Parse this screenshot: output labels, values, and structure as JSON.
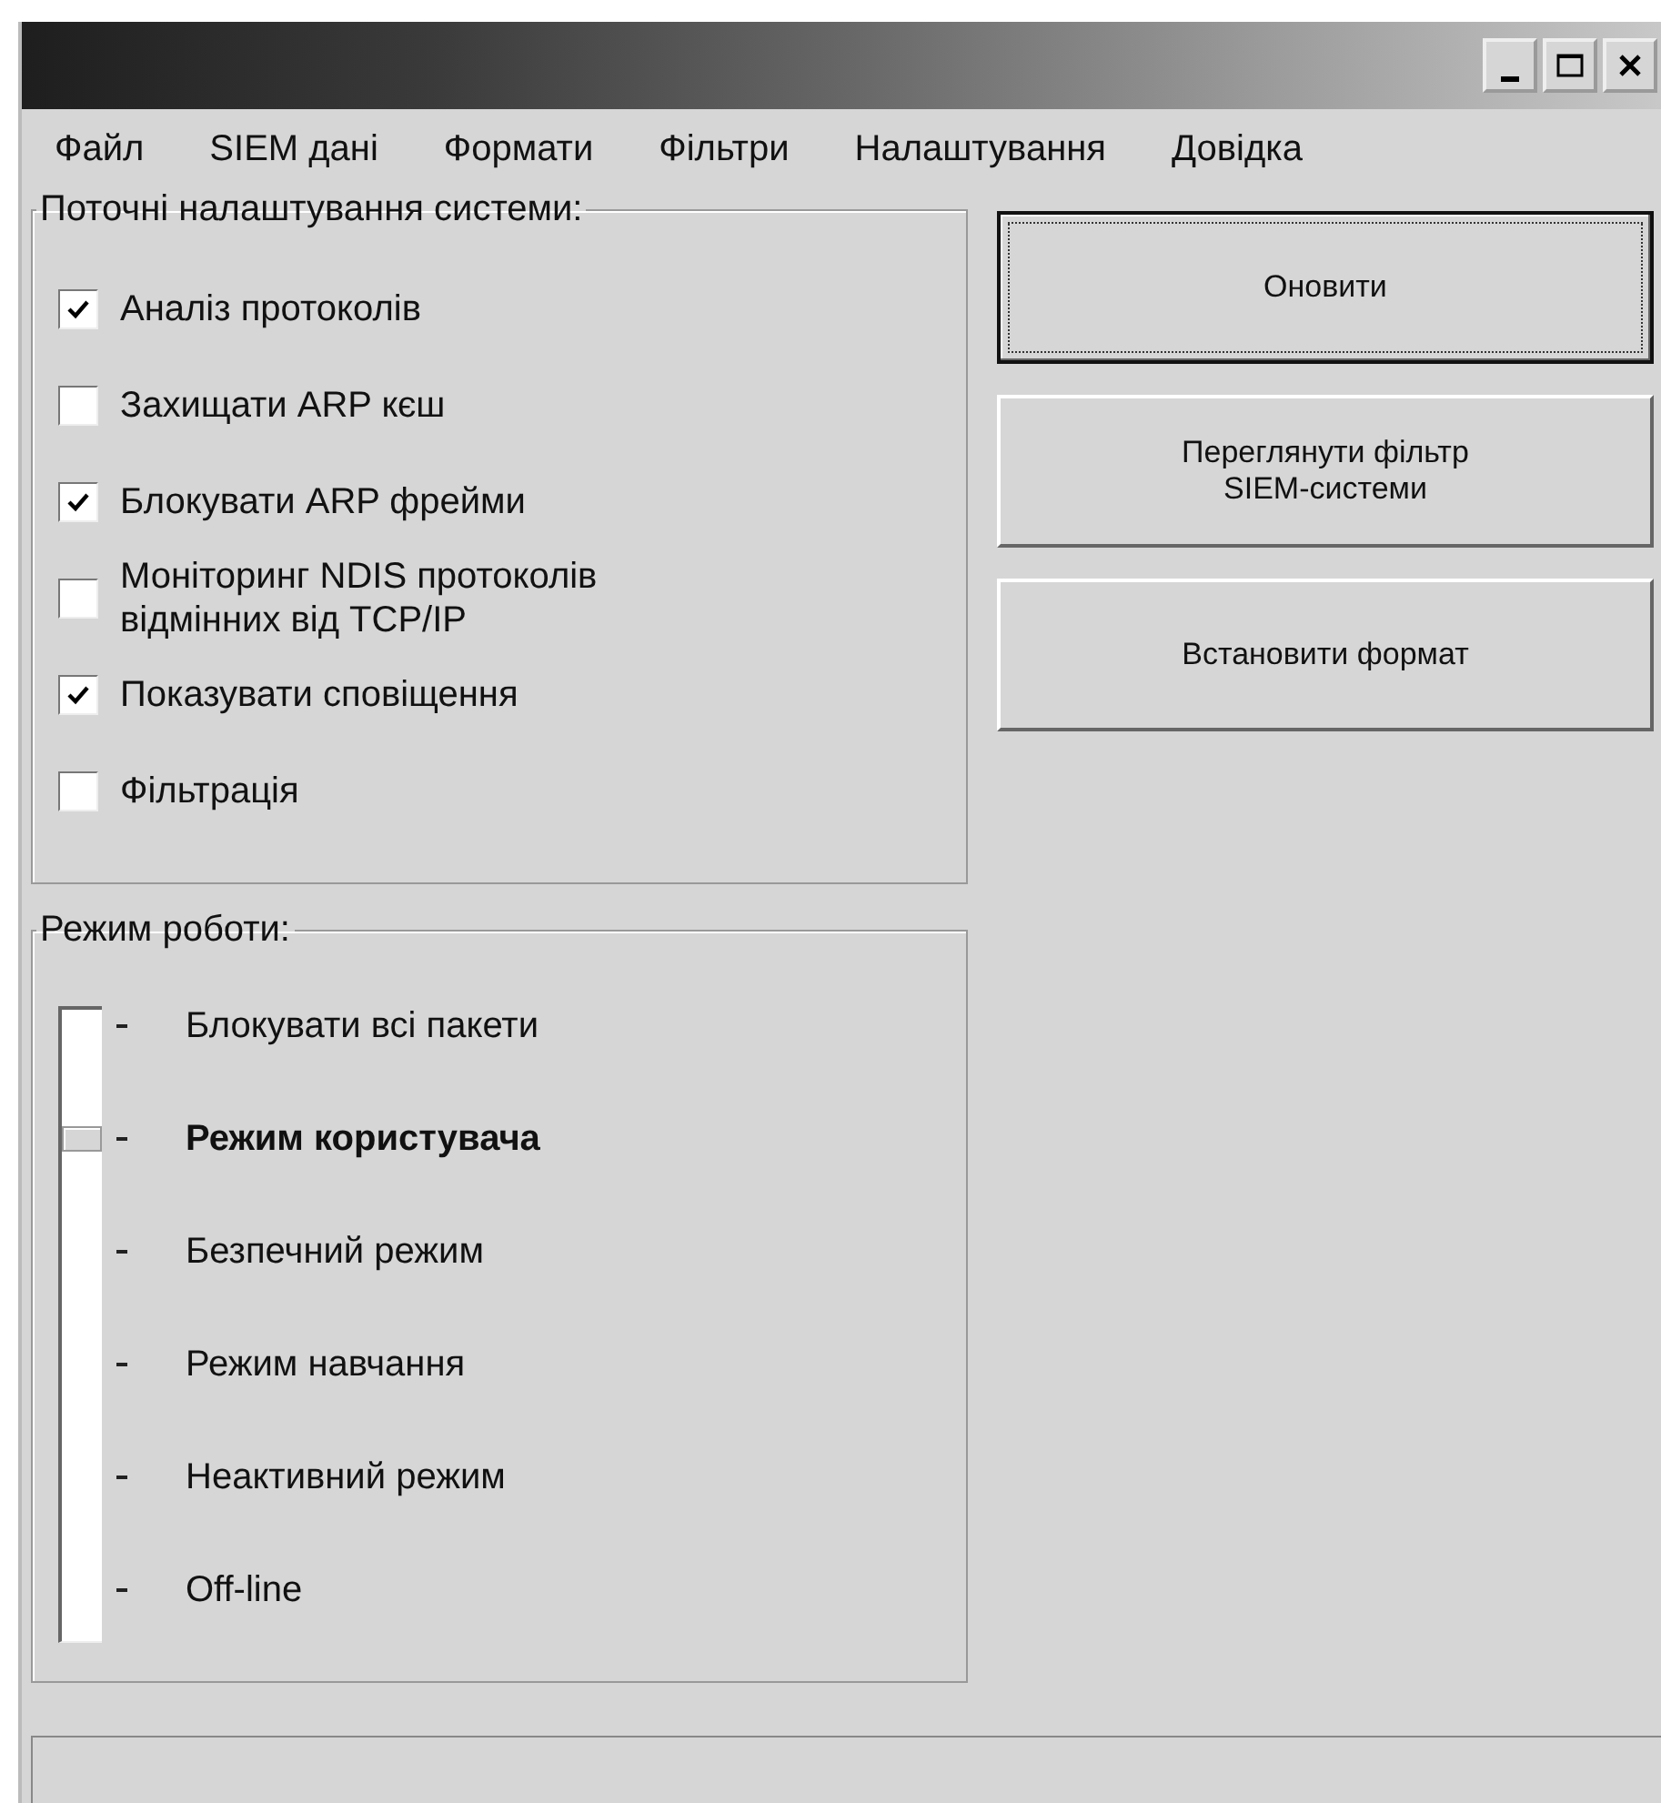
{
  "menu": [
    {
      "label": "Файл"
    },
    {
      "label": "SIEM дані"
    },
    {
      "label": "Формати"
    },
    {
      "label": "Фільтри"
    },
    {
      "label": "Налаштування"
    },
    {
      "label": "Довідка"
    }
  ],
  "settings": {
    "title": "Поточні налаштування системи:",
    "options": [
      {
        "label": "Аналіз протоколів",
        "checked": true
      },
      {
        "label": "Захищати ARP кєш",
        "checked": false
      },
      {
        "label": "Блокувати ARP фрейми",
        "checked": true
      },
      {
        "label": "Моніторинг NDIS протоколів відмінних від TCP/IP",
        "checked": false
      },
      {
        "label": "Показувати сповіщення",
        "checked": true
      },
      {
        "label": "Фільтрація",
        "checked": false
      }
    ]
  },
  "mode": {
    "title": "Режим роботи:",
    "modes": [
      {
        "label": "Блокувати всі пакети",
        "selected": false
      },
      {
        "label": "Режим користувача",
        "selected": true
      },
      {
        "label": "Безпечний режим",
        "selected": false
      },
      {
        "label": "Режим навчання",
        "selected": false
      },
      {
        "label": "Неактивний режим",
        "selected": false
      },
      {
        "label": "Off-line",
        "selected": false
      }
    ]
  },
  "buttons": [
    {
      "label": "Оновити",
      "focused": true
    },
    {
      "label": "Переглянути фільтр SIEM-системи",
      "focused": false
    },
    {
      "label": "Встановити формат",
      "focused": false
    }
  ]
}
